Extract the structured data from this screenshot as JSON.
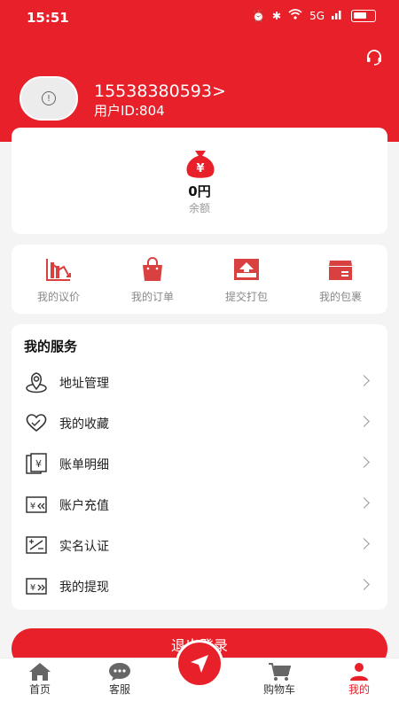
{
  "status": {
    "time": "15:51",
    "net": "5G"
  },
  "user": {
    "phone": "15538380593>",
    "id": "用户ID:804"
  },
  "balance": {
    "amount": "0円",
    "label": "余额"
  },
  "orders": [
    {
      "label": "我的议价",
      "icon": "bargain-chart-icon"
    },
    {
      "label": "我的订单",
      "icon": "shopping-bag-icon"
    },
    {
      "label": "提交打包",
      "icon": "upload-box-icon"
    },
    {
      "label": "我的包裹",
      "icon": "package-icon"
    }
  ],
  "services": {
    "title": "我的服务",
    "items": [
      {
        "label": "地址管理",
        "icon": "location-pin-icon"
      },
      {
        "label": "我的收藏",
        "icon": "heart-icon"
      },
      {
        "label": "账单明细",
        "icon": "bill-icon"
      },
      {
        "label": "账户充值",
        "icon": "recharge-icon"
      },
      {
        "label": "实名认证",
        "icon": "id-verify-icon"
      },
      {
        "label": "我的提现",
        "icon": "withdraw-icon"
      }
    ]
  },
  "logout": {
    "label": "退出登录"
  },
  "tabs": [
    {
      "label": "首页",
      "icon": "home-icon"
    },
    {
      "label": "客服",
      "icon": "chat-icon"
    },
    {
      "label": "",
      "icon": "send-icon"
    },
    {
      "label": "购物车",
      "icon": "cart-icon"
    },
    {
      "label": "我的",
      "icon": "user-icon"
    }
  ],
  "colors": {
    "brand": "#e8202a",
    "background": "#f4f4f4"
  }
}
